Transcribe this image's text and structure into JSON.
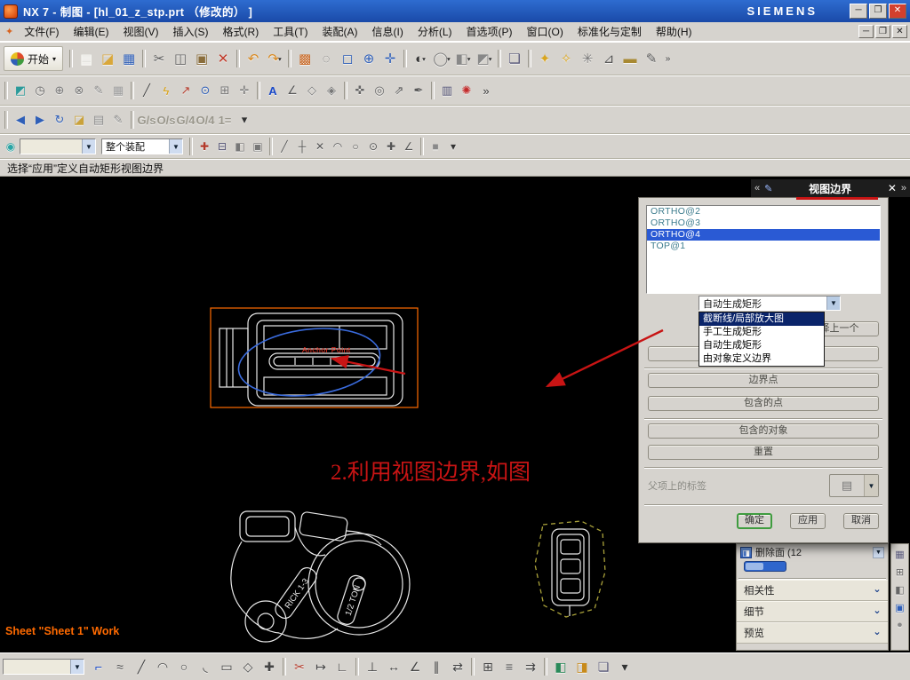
{
  "window": {
    "title": "NX 7 - 制图 - [hl_01_z_stp.prt （修改的） ]",
    "brand": "SIEMENS",
    "controls": {
      "minimize": "─",
      "maximize": "❐",
      "close": "✕"
    }
  },
  "menu": {
    "items": [
      "文件(F)",
      "编辑(E)",
      "视图(V)",
      "插入(S)",
      "格式(R)",
      "工具(T)",
      "装配(A)",
      "信息(I)",
      "分析(L)",
      "首选项(P)",
      "窗口(O)",
      "标准化与定制",
      "帮助(H)"
    ],
    "mdi_controls": {
      "minimize": "─",
      "maximize": "❐",
      "close": "✕"
    }
  },
  "prompt": "选择“应用”定义自动矩形视图边界",
  "toolbars": {
    "start_label": "开始",
    "assembly_scope": "整个装配",
    "selection_filter": "",
    "row1": [
      {
        "sep": 1
      },
      {
        "n": "new-file-button",
        "g": "▤",
        "c": "#f7f7f2"
      },
      {
        "n": "open-file-button",
        "g": "◪",
        "c": "#d9a73a"
      },
      {
        "n": "save-button",
        "g": "▦",
        "c": "#2f5fb8"
      },
      {
        "sep": 1
      },
      {
        "n": "cut-button",
        "g": "✂",
        "c": "#555555"
      },
      {
        "n": "copy-button",
        "g": "◫",
        "c": "#666666"
      },
      {
        "n": "paste-button",
        "g": "▣",
        "c": "#8a6d3b"
      },
      {
        "n": "delete-button",
        "g": "✕",
        "c": "#c03a2a"
      },
      {
        "sep": 1
      },
      {
        "n": "undo-button",
        "g": "↶",
        "c": "#d8881f"
      },
      {
        "n": "redo-button",
        "g": "↷",
        "c": "#d8881f",
        "dd": 1
      },
      {
        "sep": 1
      },
      {
        "n": "screenshot-button",
        "g": "▩",
        "c": "#c8641e"
      },
      {
        "n": "select-box-button",
        "g": "◌",
        "c": "#777777"
      },
      {
        "n": "zoom-window-button",
        "g": "◻",
        "c": "#2f5fb8"
      },
      {
        "n": "zoom-in-out-button",
        "g": "⊕",
        "c": "#2f5fb8"
      },
      {
        "n": "pan-button",
        "g": "✛",
        "c": "#2f5fb8"
      },
      {
        "sep": 1
      },
      {
        "n": "shaded-view-button",
        "g": "◐",
        "c": "#333333",
        "dd": 1
      },
      {
        "n": "wireframe-view-button",
        "g": "◯",
        "c": "#777777",
        "dd": 1
      },
      {
        "n": "orient-view-button",
        "g": "◧",
        "c": "#888888",
        "dd": 1
      },
      {
        "n": "iso-view-button",
        "g": "◩",
        "c": "#888888",
        "dd": 1
      },
      {
        "sep": 1
      },
      {
        "n": "window-button",
        "g": "❏",
        "c": "#555577"
      },
      {
        "sep": 1
      },
      {
        "n": "key-1-button",
        "g": "✦",
        "c": "#d9a520"
      },
      {
        "n": "key-2-button",
        "g": "✧",
        "c": "#d9a520"
      },
      {
        "n": "tools-button",
        "g": "✳",
        "c": "#777777"
      },
      {
        "n": "measure-button",
        "g": "⊿",
        "c": "#555555"
      },
      {
        "n": "ruler-button",
        "g": "▬",
        "c": "#a88932"
      },
      {
        "n": "annotate-button",
        "g": "✎",
        "c": "#555555"
      },
      {
        "n": "toolbar-overflow",
        "g": "»",
        "cls": "ov"
      }
    ],
    "row2": [
      {
        "sep": 1
      },
      {
        "n": "snap-toggle-button",
        "g": "◩",
        "c": "#2a9a9a"
      },
      {
        "n": "delay-button",
        "g": "◷",
        "c": "#666666"
      },
      {
        "n": "point-target-button",
        "g": "⊕",
        "c": "#777777"
      },
      {
        "n": "point-target-2-button",
        "g": "⊗",
        "c": "#777777"
      },
      {
        "n": "edit-sketch-button",
        "g": "✎",
        "c": "#888888"
      },
      {
        "n": "grid-button",
        "g": "▦",
        "c": "#999999"
      },
      {
        "sep": 1
      },
      {
        "n": "line-tool-button",
        "g": "╱",
        "c": "#444444"
      },
      {
        "n": "flash-button",
        "g": "ϟ",
        "c": "#d8a012"
      },
      {
        "n": "leader-arrow-button",
        "g": "↗",
        "c": "#b33a2a"
      },
      {
        "n": "zoom-target-button",
        "g": "⊙",
        "c": "#2f5fb8"
      },
      {
        "n": "grid-plus-button",
        "g": "⊞",
        "c": "#777777"
      },
      {
        "n": "crosshair-button",
        "g": "✛",
        "c": "#777777"
      },
      {
        "sep": 1
      },
      {
        "n": "text-annotation-button",
        "g": "A",
        "c": "#1a49c8",
        "cls": "bold"
      },
      {
        "n": "angle-dimension-button",
        "g": "∠",
        "c": "#555555"
      },
      {
        "n": "datum-plane-button",
        "g": "◇",
        "c": "#777777"
      },
      {
        "n": "balloon-button",
        "g": "◈",
        "c": "#777777"
      },
      {
        "sep": 1
      },
      {
        "n": "center-mark-button",
        "g": "✜",
        "c": "#666666"
      },
      {
        "n": "target-circle-button",
        "g": "◎",
        "c": "#666666"
      },
      {
        "n": "leader-button",
        "g": "⇗",
        "c": "#555555"
      },
      {
        "n": "edit-annotation-button",
        "g": "✒",
        "c": "#555555"
      },
      {
        "sep": 1
      },
      {
        "n": "table-button",
        "g": "▥",
        "c": "#555577"
      },
      {
        "n": "custom-wheel-button",
        "g": "✺",
        "c": "#c22a2a"
      },
      {
        "n": "toolbar-overflow",
        "g": "»",
        "cls": "ov"
      }
    ],
    "row3": [
      {
        "sep": 1
      },
      {
        "n": "prev-sheet-button",
        "g": "◀",
        "c": "#2f5fb8"
      },
      {
        "n": "next-sheet-button",
        "g": "▶",
        "c": "#2f5fb8"
      },
      {
        "n": "update-views-button",
        "g": "↻",
        "c": "#2f5fb8"
      },
      {
        "n": "drawing-folder-button",
        "g": "◪",
        "c": "#caa23a"
      },
      {
        "n": "note-button",
        "g": "▤",
        "c": "#888888"
      },
      {
        "n": "edit-note-button",
        "g": "✎",
        "c": "#888888"
      },
      {
        "sep": 1
      },
      {
        "n": "grid-snap-button",
        "t": "G/s",
        "cls": "txt"
      },
      {
        "n": "object-snap-button",
        "t": "O/s",
        "cls": "txt"
      },
      {
        "n": "grid-4-button",
        "t": "G/4",
        "cls": "txt"
      },
      {
        "n": "object-4-button",
        "t": "O/4",
        "cls": "txt"
      },
      {
        "n": "scale-1-button",
        "t": "1=",
        "cls": "txt"
      },
      {
        "n": "toolbar-overflow",
        "g": "▾",
        "cls": "ov"
      }
    ],
    "row4": [
      {
        "sep": 1
      },
      {
        "n": "add-filter-button",
        "g": "✚",
        "c": "#b33a2a"
      },
      {
        "n": "remove-filter-button",
        "g": "⊟",
        "c": "#555577"
      },
      {
        "n": "solid-filter-button",
        "g": "◧",
        "c": "#777777"
      },
      {
        "n": "face-filter-button",
        "g": "▣",
        "c": "#777777"
      },
      {
        "sep": 1
      },
      {
        "n": "snap-endpoint-button",
        "g": "╱",
        "c": "#555555"
      },
      {
        "n": "snap-midpoint-button",
        "g": "┼",
        "c": "#555555"
      },
      {
        "n": "snap-intersection-button",
        "g": "✕",
        "c": "#555555"
      },
      {
        "n": "snap-arc-button",
        "g": "◠",
        "c": "#555555"
      },
      {
        "n": "snap-circle-button",
        "g": "○",
        "c": "#555555"
      },
      {
        "n": "snap-quadrant-button",
        "g": "⊙",
        "c": "#555555"
      },
      {
        "n": "snap-point-button",
        "g": "✚",
        "c": "#555555"
      },
      {
        "n": "snap-angle-button",
        "g": "∠",
        "c": "#555555"
      },
      {
        "sep": 1
      },
      {
        "n": "work-part-button",
        "g": "■",
        "c": "#8a8a8a"
      },
      {
        "n": "toolbar-overflow",
        "g": "▾",
        "cls": "ov"
      }
    ],
    "bottom": [
      {
        "n": "profile-button",
        "g": "⌐",
        "c": "#1a49c8"
      },
      {
        "n": "spline-button",
        "g": "≈",
        "c": "#444444"
      },
      {
        "n": "line-button",
        "g": "╱",
        "c": "#444444"
      },
      {
        "n": "arc-button",
        "g": "◠",
        "c": "#444444"
      },
      {
        "n": "circle-button",
        "g": "○",
        "c": "#444444"
      },
      {
        "n": "fillet-button",
        "g": "◟",
        "c": "#444444"
      },
      {
        "n": "rectangle-button",
        "g": "▭",
        "c": "#444444"
      },
      {
        "n": "polygon-button",
        "g": "◇",
        "c": "#444444"
      },
      {
        "n": "point-button",
        "g": "✚",
        "c": "#444444"
      },
      {
        "sep": 1
      },
      {
        "n": "quick-trim-button",
        "g": "✂",
        "c": "#b33a2a"
      },
      {
        "n": "quick-extend-button",
        "g": "↦",
        "c": "#444444"
      },
      {
        "n": "make-corner-button",
        "g": "∟",
        "c": "#444444"
      },
      {
        "sep": 1
      },
      {
        "n": "constraints-button",
        "g": "⊥",
        "c": "#444444"
      },
      {
        "n": "dimension-button",
        "g": "↔",
        "c": "#444444"
      },
      {
        "n": "angle-dim-button",
        "g": "∠",
        "c": "#444444"
      },
      {
        "n": "parallel-dim-button",
        "g": "∥",
        "c": "#444444"
      },
      {
        "n": "mirror-curve-button",
        "g": "⇄",
        "c": "#444444"
      },
      {
        "sep": 1
      },
      {
        "n": "pattern-curve-button",
        "g": "⊞",
        "c": "#444444"
      },
      {
        "n": "offset-curve-button",
        "g": "≡",
        "c": "#444444"
      },
      {
        "n": "project-curve-button",
        "g": "⇉",
        "c": "#444444"
      },
      {
        "sep": 1
      },
      {
        "n": "style-button",
        "g": "◧",
        "c": "#2a8a5a"
      },
      {
        "n": "fill-color-button",
        "g": "◨",
        "c": "#c88a1a"
      },
      {
        "n": "sketch-pin-button",
        "g": "❏",
        "c": "#555577"
      },
      {
        "n": "more-tools-button",
        "g": "▾",
        "cls": "ov"
      }
    ],
    "mini_strip": [
      {
        "n": "mini-panel-1-button",
        "g": "▦",
        "c": "#555577"
      },
      {
        "n": "mini-panel-2-button",
        "g": "⊞",
        "c": "#666666"
      },
      {
        "n": "mini-panel-3-button",
        "g": "◧",
        "c": "#666666"
      },
      {
        "n": "mini-panel-4-button",
        "g": "▣",
        "c": "#2f5fb8"
      },
      {
        "n": "mini-panel-5-button",
        "g": "●",
        "c": "#888888"
      }
    ]
  },
  "dialog": {
    "title": "视图边界",
    "nav_prev": "«",
    "nav_next": "»",
    "close": "✕",
    "list_items": [
      {
        "t": "ORTHO@2"
      },
      {
        "t": "ORTHO@3"
      },
      {
        "t": "ORTHO@4",
        "sel": true
      },
      {
        "t": "TOP@1"
      }
    ],
    "dropdown_value": "自动生成矩形",
    "dropdown_options": [
      {
        "t": "截断线/局部放大图",
        "sel": true
      },
      {
        "t": "手工生成矩形"
      },
      {
        "t": "自动生成矩形"
      },
      {
        "t": "由对象定义边界"
      }
    ],
    "deselect_button": "取消选择上一个",
    "action_buttons": [
      "边界点",
      "包含的点",
      "包含的对象",
      "重置"
    ],
    "parent_label": "父项上的标签",
    "footer_buttons": [
      "确定",
      "应用",
      "取消"
    ]
  },
  "side_panel": {
    "feature_label": "删除面 (12",
    "sections": [
      {
        "label": "相关性"
      },
      {
        "label": "细节"
      },
      {
        "label": "预览"
      }
    ]
  },
  "canvas": {
    "annotation": "2.利用视图边界,如图",
    "anchor_label": "Anchor Point",
    "sheet_status": "Sheet \"Sheet 1\" Work",
    "part_labels": [
      "RICK 1-3",
      "1/2 TON"
    ]
  },
  "colors": {
    "canvas_bg": "#000000",
    "selection_orange": "#ff6a00",
    "annotation_red": "#c81414",
    "list_highlight_blue": "#2a5ad4",
    "dropdown_highlight_navy": "#0a246a",
    "sketch_blue": "#3a6bdd",
    "boundary_yellow": "#a9a13a"
  }
}
